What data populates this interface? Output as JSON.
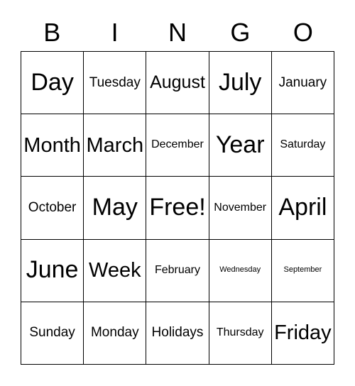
{
  "card": {
    "header_letters": [
      "B",
      "I",
      "N",
      "G",
      "O"
    ],
    "columns": 5,
    "rows": 5,
    "colors": {
      "background": "#ffffff",
      "text": "#000000",
      "grid_line": "#000000"
    },
    "free_space": "Free!",
    "cells": [
      [
        {
          "label": "Day",
          "size": "fs-xxl"
        },
        {
          "label": "Tuesday",
          "size": "fs-md"
        },
        {
          "label": "August",
          "size": "fs-lg"
        },
        {
          "label": "July",
          "size": "fs-xxl"
        },
        {
          "label": "January",
          "size": "fs-md"
        }
      ],
      [
        {
          "label": "Month",
          "size": "fs-xl"
        },
        {
          "label": "March",
          "size": "fs-xl"
        },
        {
          "label": "December",
          "size": "fs-sm"
        },
        {
          "label": "Year",
          "size": "fs-xxl"
        },
        {
          "label": "Saturday",
          "size": "fs-sm"
        }
      ],
      [
        {
          "label": "October",
          "size": "fs-md"
        },
        {
          "label": "May",
          "size": "fs-xxl"
        },
        {
          "label": "Free!",
          "size": "fs-xxl"
        },
        {
          "label": "November",
          "size": "fs-sm"
        },
        {
          "label": "April",
          "size": "fs-xxl"
        }
      ],
      [
        {
          "label": "June",
          "size": "fs-xxl"
        },
        {
          "label": "Week",
          "size": "fs-xl"
        },
        {
          "label": "February",
          "size": "fs-sm"
        },
        {
          "label": "Wednesday",
          "size": "fs-xxs"
        },
        {
          "label": "September",
          "size": "fs-xxs"
        }
      ],
      [
        {
          "label": "Sunday",
          "size": "fs-md"
        },
        {
          "label": "Monday",
          "size": "fs-md"
        },
        {
          "label": "Holidays",
          "size": "fs-md"
        },
        {
          "label": "Thursday",
          "size": "fs-sm"
        },
        {
          "label": "Friday",
          "size": "fs-xl"
        }
      ]
    ]
  }
}
